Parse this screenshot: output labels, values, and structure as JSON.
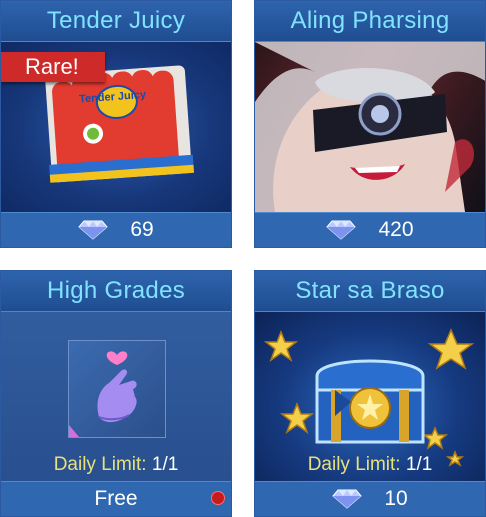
{
  "cards": [
    {
      "title": "Tender Juicy",
      "badge": "Rare!",
      "price": "69",
      "package_text": "Tender Juicy"
    },
    {
      "title": "Aling Pharsing",
      "price": "420"
    },
    {
      "title": "High Grades",
      "daily_label": "Daily Limit:",
      "daily_value": "1/1",
      "price": "Free"
    },
    {
      "title": "Star sa Braso",
      "daily_label": "Daily Limit:",
      "daily_value": "1/1",
      "price": "10"
    }
  ],
  "colors": {
    "title_text": "#7fe3ff",
    "card_bg": "#1b3c78",
    "footer_bg": "#2f68b1",
    "rare_badge": "#cf2a2a",
    "daily_label": "#e8e07a"
  },
  "icons": [
    "diamond-icon",
    "finger-heart-icon",
    "star-icon",
    "treasure-chest-icon"
  ]
}
